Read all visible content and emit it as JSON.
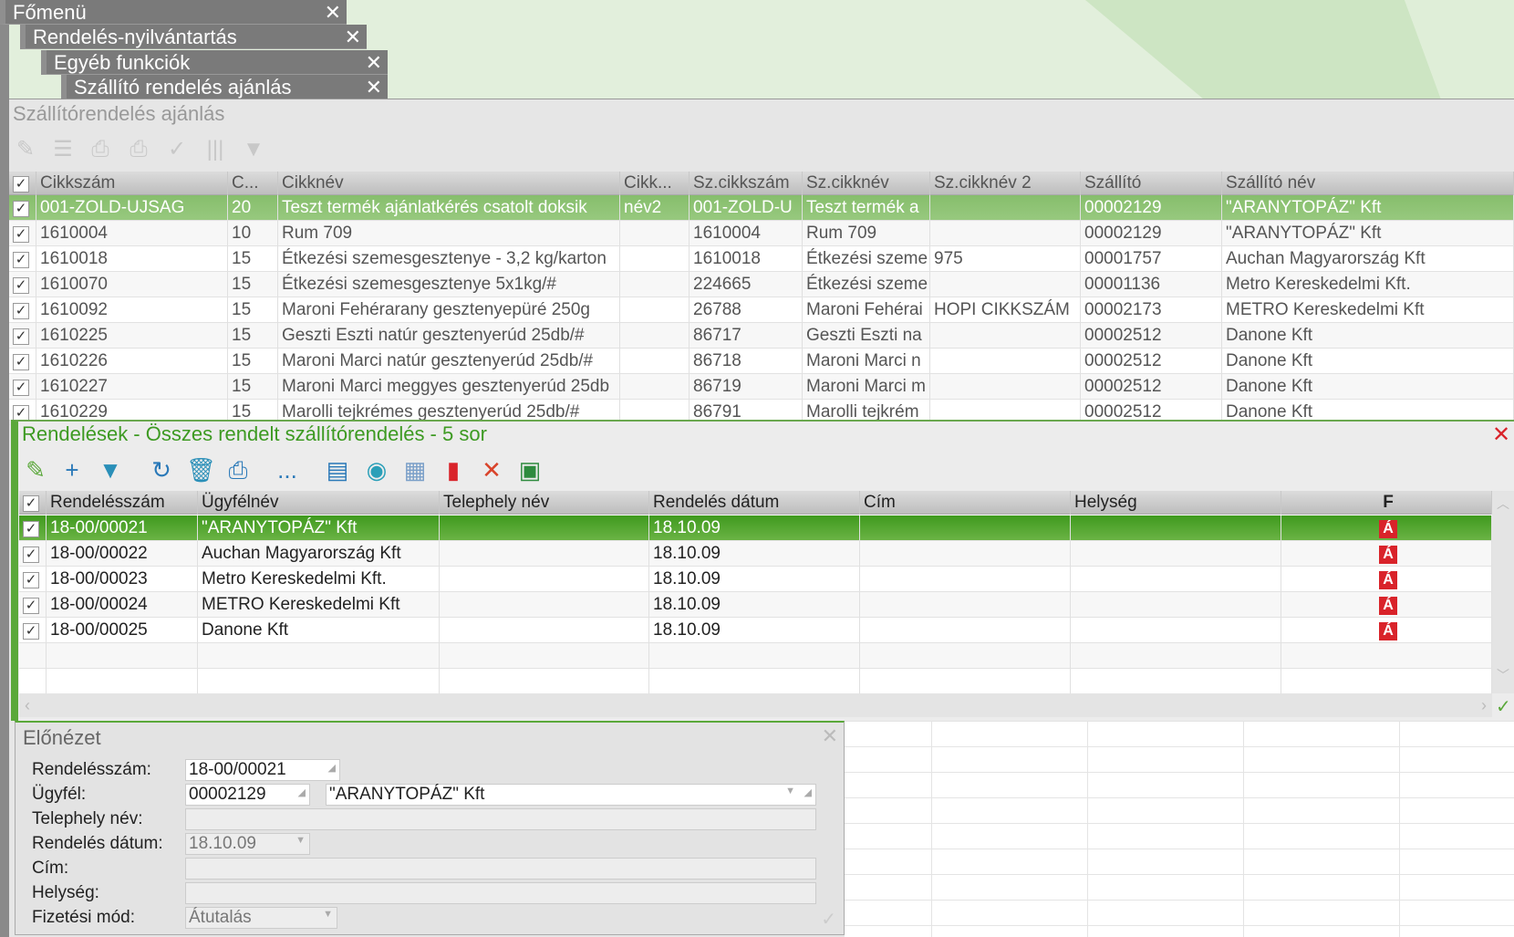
{
  "tabs": [
    "Főmenü",
    "Rendelés-nyilvántartás",
    "Egyéb funkciók",
    "Szállító rendelés ajánlás"
  ],
  "window_title": "Szállítórendelés ajánlás",
  "top_grid": {
    "columns": [
      "Cikkszám",
      "C...",
      "Cikknév",
      "Cikk...",
      "Sz.cikkszám",
      "Sz.cikknév",
      "Sz.cikknév 2",
      "Szállító",
      "Szállító név"
    ],
    "rows": [
      [
        "001-ZOLD-UJSAG",
        "20",
        "Teszt termék ajánlatkérés csatolt doksik",
        "név2",
        "001-ZOLD-U",
        "Teszt termék a",
        "",
        "00002129",
        "\"ARANYTOPÁZ\" Kft"
      ],
      [
        "1610004",
        "10",
        "Rum 709",
        "",
        "1610004",
        "Rum 709",
        "",
        "00002129",
        "\"ARANYTOPÁZ\" Kft"
      ],
      [
        "1610018",
        "15",
        "Étkezési szemesgesztenye - 3,2 kg/karton",
        "",
        "1610018",
        "Étkezési szeme",
        "975",
        "00001757",
        "Auchan Magyarország Kft"
      ],
      [
        "1610070",
        "15",
        "Étkezési szemesgesztenye 5x1kg/#",
        "",
        "224665",
        "Étkezési szeme",
        "",
        "00001136",
        "Metro Kereskedelmi Kft."
      ],
      [
        "1610092",
        "15",
        "Maroni Fehérarany gesztenyepüré 250g",
        "",
        "26788",
        "Maroni Fehérai",
        "HOPI CIKKSZÁM",
        "00002173",
        "METRO Kereskedelmi Kft"
      ],
      [
        "1610225",
        "15",
        "Geszti Eszti natúr gesztenyerúd 25db/#",
        "",
        "86717",
        "Geszti Eszti na",
        "",
        "00002512",
        "Danone  Kft"
      ],
      [
        "1610226",
        "15",
        "Maroni Marci natúr gesztenyerúd 25db/#",
        "",
        "86718",
        "Maroni Marci n",
        "",
        "00002512",
        "Danone  Kft"
      ],
      [
        "1610227",
        "15",
        "Maroni Marci meggyes gesztenyerúd 25db",
        "",
        "86719",
        "Maroni Marci m",
        "",
        "00002512",
        "Danone  Kft"
      ],
      [
        "1610229",
        "15",
        "Marolli tejkrémes gesztenyerúd 25db/#",
        "",
        "86791",
        "Marolli tejkrém",
        "",
        "00002512",
        "Danone  Kft"
      ]
    ]
  },
  "orders": {
    "title": "Rendelések - Összes rendelt szállítórendelés - 5 sor",
    "columns": [
      "Rendelésszám",
      "Ügyfélnév",
      "Telephely név",
      "Rendelés dátum",
      "Cím",
      "Helység",
      "F"
    ],
    "rows": [
      [
        "18-00/00021",
        "\"ARANYTOPÁZ\" Kft",
        "",
        "18.10.09",
        "",
        "",
        "Á"
      ],
      [
        "18-00/00022",
        "Auchan Magyarország Kft",
        "",
        "18.10.09",
        "",
        "",
        "Á"
      ],
      [
        "18-00/00023",
        "Metro Kereskedelmi Kft.",
        "",
        "18.10.09",
        "",
        "",
        "Á"
      ],
      [
        "18-00/00024",
        "METRO Kereskedelmi Kft",
        "",
        "18.10.09",
        "",
        "",
        "Á"
      ],
      [
        "18-00/00025",
        "Danone  Kft",
        "",
        "18.10.09",
        "",
        "",
        "Á"
      ]
    ],
    "toolbar_more": "..."
  },
  "preview": {
    "title": "Előnézet",
    "labels": {
      "order_no": "Rendelésszám:",
      "customer": "Ügyfél:",
      "site": "Telephely név:",
      "date": "Rendelés dátum:",
      "address": "Cím:",
      "city": "Helység:",
      "payment": "Fizetési mód:"
    },
    "values": {
      "order_no": "18-00/00021",
      "customer_code": "00002129",
      "customer_name": "\"ARANYTOPÁZ\" Kft",
      "site": "",
      "date": "18.10.09",
      "address": "",
      "city": "",
      "payment": "Átutalás"
    }
  },
  "colors": {
    "accent": "#5aa83a",
    "selected": "#4a9e28",
    "flag": "#d9232a"
  }
}
